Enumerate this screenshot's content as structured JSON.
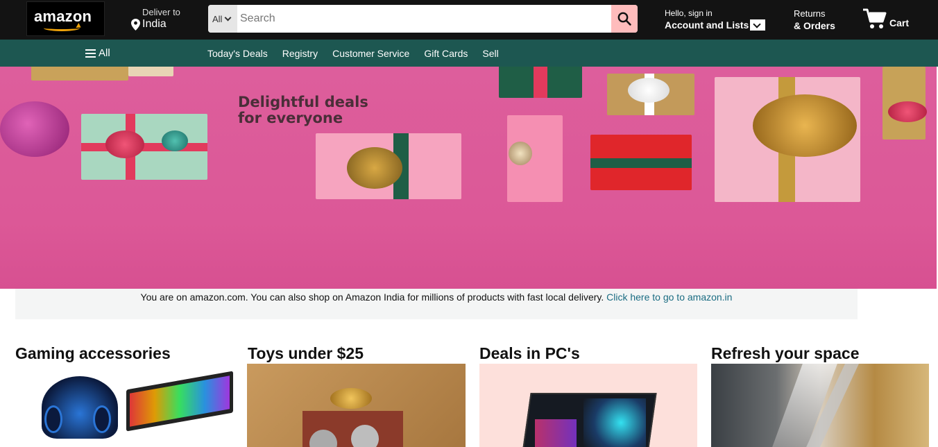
{
  "header": {
    "logo_text": "amazon",
    "deliver_line1": "Deliver to",
    "deliver_line2": "India",
    "search_category": "All",
    "search_placeholder": "Search",
    "account_line1": "Hello, sign in",
    "account_line2": "Account and Lists",
    "returns_line1": "Returns",
    "returns_line2": "& Orders",
    "cart_label": "Cart"
  },
  "subnav": {
    "all_label": "All",
    "links": [
      "Today's Deals",
      "Registry",
      "Customer Service",
      "Gift Cards",
      "Sell"
    ]
  },
  "hero": {
    "title_line1": "Delightful deals",
    "title_line2": "for everyone"
  },
  "notice": {
    "text": "You are on amazon.com. You can also shop on Amazon India for millions of products with fast local delivery. ",
    "link": "Click here to go to amazon.in"
  },
  "cards": [
    {
      "title": "Gaming accessories"
    },
    {
      "title": "Toys under $25"
    },
    {
      "title": "Deals in PC's"
    },
    {
      "title": "Refresh your space"
    }
  ],
  "colors": {
    "topnav_bg": "#131313",
    "subnav_bg": "#1d5751",
    "hero_bg": "#dc5897",
    "search_button": "#ffbcbc",
    "link": "#1a6c82",
    "logo_smile": "#f0a30a"
  }
}
